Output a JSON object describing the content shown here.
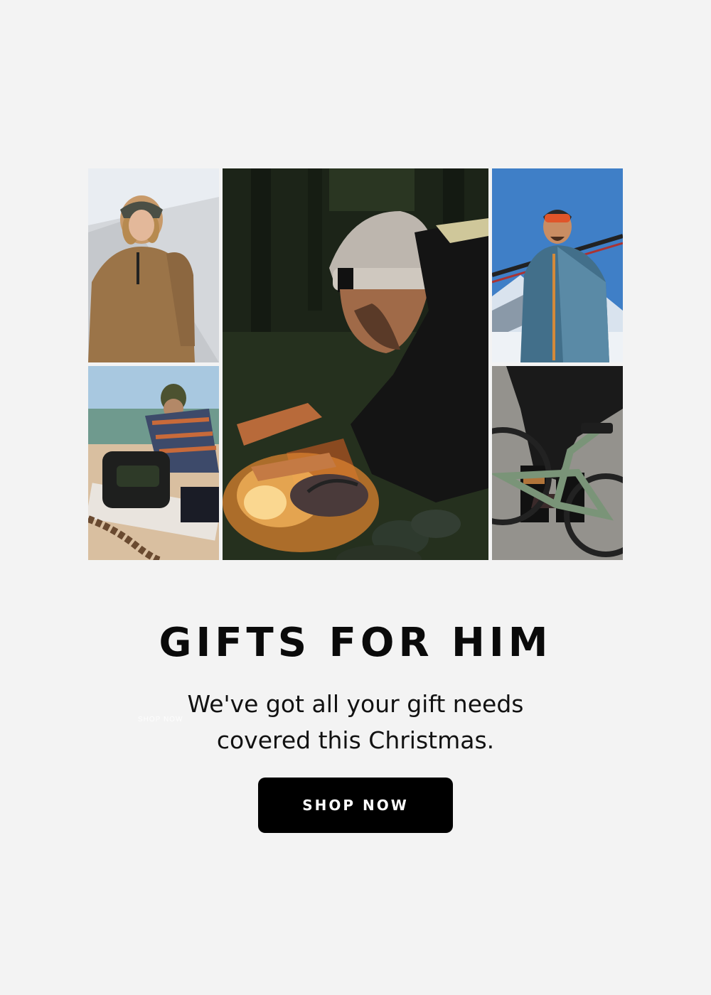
{
  "hero": {
    "headline": "GIFTS FOR HIM",
    "subline_line1": "We've got all your gift needs",
    "subline_line2": "covered this Christmas.",
    "ghost_label": "SHOP NOW",
    "cta_label": "SHOP NOW"
  },
  "colors": {
    "background": "#f3f3f3",
    "cta_bg": "#000000",
    "cta_text": "#ffffff",
    "headline": "#0a0a0a"
  }
}
